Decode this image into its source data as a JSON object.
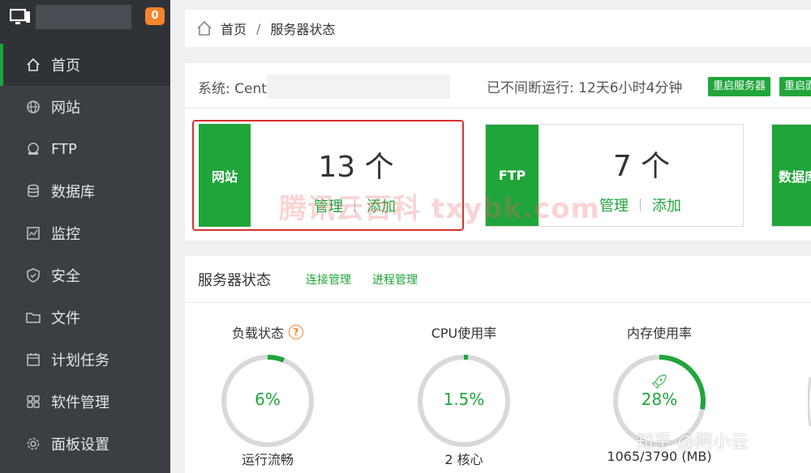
{
  "sidebar": {
    "badge": "0",
    "items": [
      {
        "label": "首页",
        "icon": "home-icon"
      },
      {
        "label": "网站",
        "icon": "globe-icon"
      },
      {
        "label": "FTP",
        "icon": "ftp-icon"
      },
      {
        "label": "数据库",
        "icon": "database-icon"
      },
      {
        "label": "监控",
        "icon": "monitor-icon"
      },
      {
        "label": "安全",
        "icon": "shield-icon"
      },
      {
        "label": "文件",
        "icon": "folder-icon"
      },
      {
        "label": "计划任务",
        "icon": "calendar-icon"
      },
      {
        "label": "软件管理",
        "icon": "grid-icon"
      },
      {
        "label": "面板设置",
        "icon": "gear-icon"
      }
    ]
  },
  "breadcrumb": {
    "home": "首页",
    "sep": "/",
    "current": "服务器状态"
  },
  "system": {
    "label": "系统: Cent",
    "uptime": "已不间断运行: 12天6小时4分钟",
    "restart_server": "重启服务器",
    "restart_panel": "重启面"
  },
  "cards": [
    {
      "tag": "网站",
      "count": "13 个",
      "manage": "管理",
      "add": "添加"
    },
    {
      "tag": "FTP",
      "count": "7 个",
      "manage": "管理",
      "add": "添加"
    },
    {
      "tag": "数据库"
    }
  ],
  "status": {
    "title": "服务器状态",
    "link_conn": "连接管理",
    "link_proc": "进程管理",
    "gauges": [
      {
        "title": "负载状态",
        "help": "?",
        "value": "6%",
        "percent": 6,
        "sub": "运行流畅"
      },
      {
        "title": "CPU使用率",
        "value": "1.5%",
        "percent": 1.5,
        "sub": "2 核心"
      },
      {
        "title": "内存使用率",
        "value": "28%",
        "percent": 28,
        "sub": "1065/3790 (MB)"
      }
    ]
  },
  "watermarks": {
    "main": "腾讯云百科 txybk.com",
    "corner": "知乎 @阿小云"
  },
  "colors": {
    "accent": "#20a53a",
    "badge": "#f7832d",
    "highlight": "#d8322e",
    "sidebar": "#3b3f44"
  }
}
